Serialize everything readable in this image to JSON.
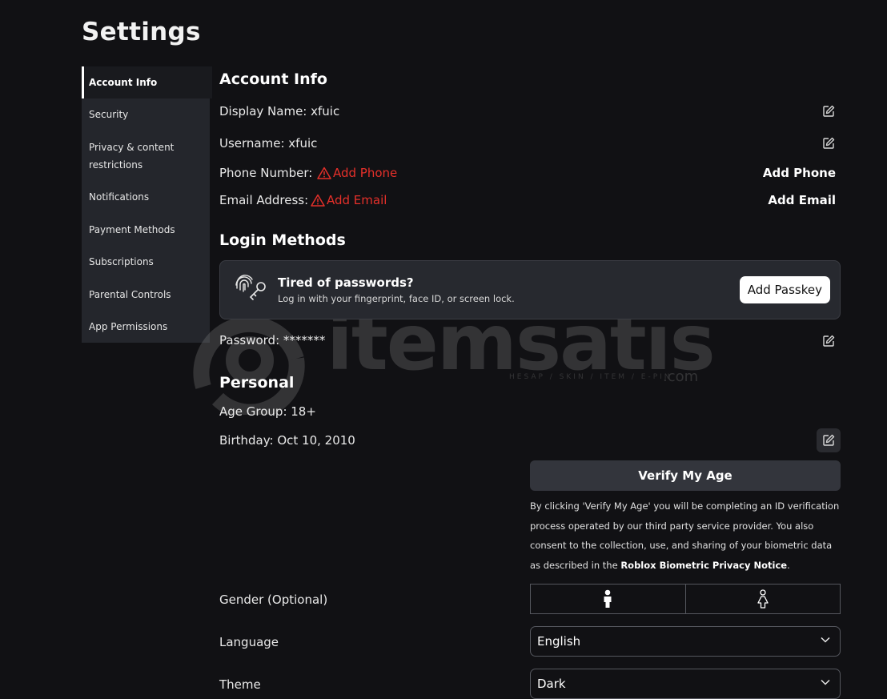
{
  "page": {
    "title": "Settings"
  },
  "sidebar": {
    "items": [
      {
        "label": "Account Info",
        "active": true
      },
      {
        "label": "Security"
      },
      {
        "label": "Privacy & content",
        "label2": "restrictions"
      },
      {
        "label": "Notifications"
      },
      {
        "label": "Payment Methods"
      },
      {
        "label": "Subscriptions"
      },
      {
        "label": "Parental Controls"
      },
      {
        "label": "App Permissions"
      }
    ]
  },
  "account_info": {
    "heading": "Account Info",
    "display_name": "Display Name: xfuic",
    "username": "Username: xfuic",
    "phone_label": "Phone Number:",
    "phone_warning": "Add Phone",
    "phone_action": "Add Phone",
    "email_label": "Email Address:",
    "email_warning": "Add Email",
    "email_action": "Add Email"
  },
  "login_methods": {
    "heading": "Login Methods",
    "passkey_title": "Tired of passwords?",
    "passkey_subtitle": "Log in with your fingerprint, face ID, or screen lock.",
    "passkey_button": "Add Passkey",
    "password": "Password: *******"
  },
  "personal": {
    "heading": "Personal",
    "age_group": "Age Group: 18+",
    "birthday": "Birthday: Oct 10, 2010",
    "verify_button": "Verify My Age",
    "verify_note_pre": "By clicking 'Verify My Age' you will be completing an ID verification process operated by our third party service provider. You also consent to the collection, use, and sharing of your biometric data as described in the ",
    "verify_note_link": "Roblox Biometric Privacy Notice",
    "verify_note_post": ".",
    "gender_label": "Gender (Optional)",
    "language_label": "Language",
    "language_value": "English",
    "theme_label": "Theme",
    "theme_value": "Dark"
  },
  "watermark": {
    "text": "itemsatıs",
    "sub": "HESAP / SKIN / ITEM / E-PIN",
    "suffix": ".com"
  },
  "colors": {
    "background": "#111114",
    "sidebar": "#24262c",
    "warning": "#e5302a",
    "card": "#27292f"
  }
}
